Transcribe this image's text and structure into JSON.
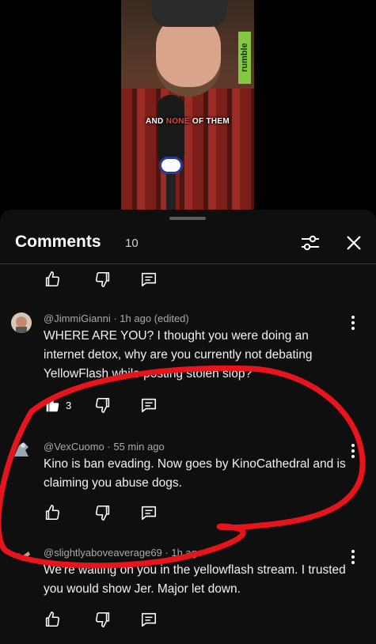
{
  "video": {
    "caption_prefix": "AND",
    "caption_highlight": "NONE",
    "caption_suffix": "OF THEM",
    "watermark": "rumble"
  },
  "panel": {
    "title": "Comments",
    "count": "10",
    "filter_icon": "sliders-icon",
    "close_icon": "close-icon"
  },
  "top_actions": {
    "like_count": ""
  },
  "comments": [
    {
      "author": "@JimmiGianni",
      "time": "1h ago (edited)",
      "text": "WHERE ARE YOU? I thought you were doing an internet detox, why are you currently not debating YellowFlash while posting stolen slop?",
      "likes": "3",
      "liked": true
    },
    {
      "author": "@VexCuomo",
      "time": "55 min ago",
      "text": "Kino is ban evading. Now goes by KinoCathedral and is claiming you abuse dogs.",
      "likes": "",
      "liked": false
    },
    {
      "author": "@slightlyaboveaverage69",
      "time": "1h ago",
      "text": "We're waiting on you in the yellowflash stream. I trusted you would show Jer. Major let down.",
      "likes": "",
      "liked": false
    }
  ],
  "colors": {
    "sheet_bg": "#0f0f0f",
    "annotation_red": "#e8141c",
    "highlight_red": "#e0443a"
  }
}
